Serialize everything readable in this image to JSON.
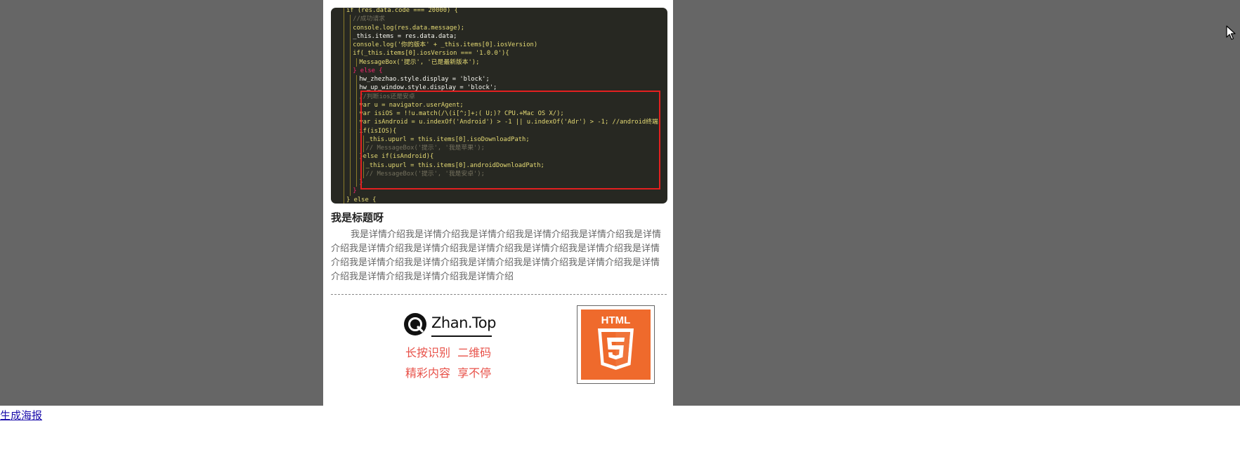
{
  "poster": {
    "code_lines": [
      {
        "indent": 0,
        "text": "if (res.data.code === 20000) {",
        "color": "#e6db74"
      },
      {
        "indent": 1,
        "text": "//成功请求",
        "color": "#75715e"
      },
      {
        "indent": 1,
        "text": "console.log(res.data.message);",
        "color": "#e6db74"
      },
      {
        "indent": 1,
        "text": "_this.items = res.data.data;",
        "color": "#f8f8f2"
      },
      {
        "indent": 1,
        "text": "console.log('你的版本' + _this.items[0].iosVersion)",
        "color": "#e6db74"
      },
      {
        "indent": 1,
        "text": "if(_this.items[0].iosVersion === '1.0.0'){",
        "color": "#e6db74"
      },
      {
        "indent": 2,
        "text": "MessageBox('提示', '已是最新版本');",
        "color": "#e6db74"
      },
      {
        "indent": 1,
        "text": "} else {",
        "color": "#f92672"
      },
      {
        "indent": 2,
        "text": "hw_zhezhao.style.display = 'block';",
        "color": "#f8f8f2"
      },
      {
        "indent": 2,
        "text": "hw_up_window.style.display = 'block';",
        "color": "#f8f8f2"
      },
      {
        "indent": 2,
        "text": "//判断ios还是安卓",
        "color": "#75715e"
      },
      {
        "indent": 2,
        "text": "var u = navigator.userAgent;",
        "color": "#e6db74"
      },
      {
        "indent": 2,
        "text": "var isiOS = !!u.match(/\\(i[^;]+;( U;)? CPU.+Mac OS X/);",
        "color": "#e6db74"
      },
      {
        "indent": 2,
        "text": "var isAndroid = u.indexOf('Android') > -1 || u.indexOf('Adr') > -1; //android终端",
        "color": "#e6db74"
      },
      {
        "indent": 2,
        "text": "if(isIOS){",
        "color": "#e6db74"
      },
      {
        "indent": 3,
        "text": "_this.upurl = this.items[0].isoDownloadPath;",
        "color": "#e6db74"
      },
      {
        "indent": 3,
        "text": "// MessageBox('提示', '我是苹果');",
        "color": "#75715e"
      },
      {
        "indent": 2,
        "text": "}else if(isAndroid){",
        "color": "#e6db74"
      },
      {
        "indent": 3,
        "text": "_this.upurl = this.items[0].androidDownloadPath;",
        "color": "#e6db74"
      },
      {
        "indent": 3,
        "text": "// MessageBox('提示', '我是安卓');",
        "color": "#75715e"
      },
      {
        "indent": 2,
        "text": "}",
        "color": "#66d9ef"
      },
      {
        "indent": 1,
        "text": "}",
        "color": "#f92672"
      },
      {
        "indent": 0,
        "text": "} else {",
        "color": "#e6db74"
      }
    ],
    "title": "我是标题呀",
    "description": "我是详情介绍我是详情介绍我是详情介绍我是详情介绍我是详情介绍我是详情介绍我是详情介绍我是详情介绍我是详情介绍我是详情介绍我是详情介绍我是详情介绍我是详情介绍我是详情介绍我是详情介绍我是详情介绍我是详情介绍我是详情介绍我是详情介绍我是详情介绍我是详情介绍",
    "brand_text": "Zhan.Top",
    "tagline_1": "长按识别  二维码",
    "tagline_2": "精彩内容  享不停",
    "qr_badge_text": "HTML",
    "qr_badge_number": "5"
  },
  "colors": {
    "overlay": "#666666",
    "accent_red": "#e8524a",
    "html5_orange": "#ef6a2c",
    "highlight_box": "#e32020",
    "link": "#1a0dab"
  },
  "icons": {
    "brand": "q-logo-icon",
    "qr": "html5-icon",
    "cursor": "mouse-cursor-icon"
  },
  "actions": {
    "generate_poster_label": "生成海报"
  }
}
